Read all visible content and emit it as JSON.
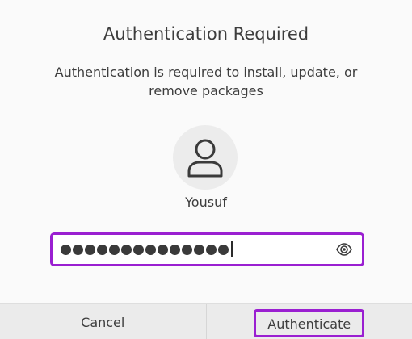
{
  "dialog": {
    "title": "Authentication Required",
    "message": "Authentication is required to install, update, or remove packages"
  },
  "user": {
    "name": "Yousuf",
    "avatar_icon": "user-icon"
  },
  "password": {
    "masked_length": 14,
    "reveal_icon": "eye-icon"
  },
  "buttons": {
    "cancel_label": "Cancel",
    "authenticate_label": "Authenticate"
  },
  "colors": {
    "focus_outline": "#9a1fd1"
  }
}
